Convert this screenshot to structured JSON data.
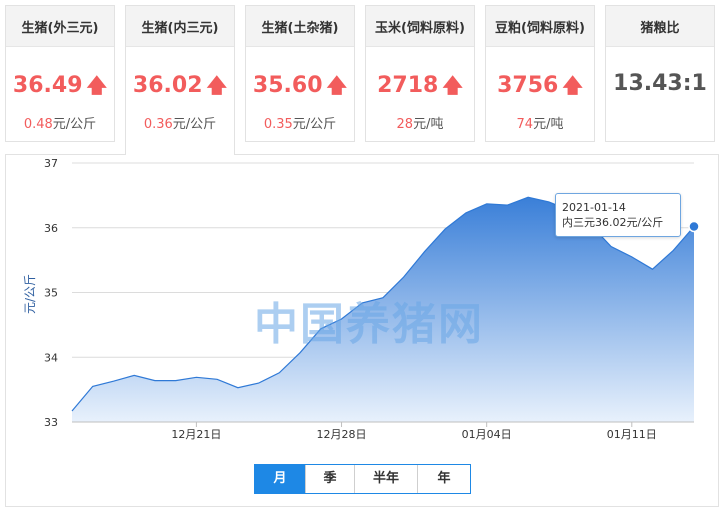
{
  "tabs": [
    {
      "title": "生猪(外三元)",
      "price": "36.49",
      "change": "0.48",
      "unit": "元/公斤",
      "trend": "up"
    },
    {
      "title": "生猪(内三元)",
      "price": "36.02",
      "change": "0.36",
      "unit": "元/公斤",
      "trend": "up"
    },
    {
      "title": "生猪(土杂猪)",
      "price": "35.60",
      "change": "0.35",
      "unit": "元/公斤",
      "trend": "up"
    },
    {
      "title": "玉米(饲料原料)",
      "price": "2718",
      "change": "28",
      "unit": "元/吨",
      "trend": "up"
    },
    {
      "title": "豆粕(饲料原料)",
      "price": "3756",
      "change": "74",
      "unit": "元/吨",
      "trend": "up"
    },
    {
      "title": "猪粮比",
      "price": "13.43:1"
    }
  ],
  "arrow_glyph": "🡅",
  "watermark": "中国养猪网",
  "tooltip": {
    "date": "2021-01-14",
    "text": "内三元36.02元/公斤"
  },
  "range_buttons": [
    "月",
    "季",
    "半年",
    "年"
  ],
  "colors": {
    "accent": "#1e88e5",
    "price_red": "#f25c5c",
    "area_top": "#3a7fd8",
    "area_bottom": "#e8f1fc"
  },
  "chart_data": {
    "type": "area",
    "ylabel": "元/公斤",
    "ylim": [
      33,
      37
    ],
    "yticks": [
      33,
      34,
      35,
      36,
      37
    ],
    "x": [
      "2020-12-15",
      "2020-12-16",
      "2020-12-17",
      "2020-12-18",
      "2020-12-19",
      "2020-12-20",
      "2020-12-21",
      "2020-12-22",
      "2020-12-23",
      "2020-12-24",
      "2020-12-25",
      "2020-12-26",
      "2020-12-27",
      "2020-12-28",
      "2020-12-29",
      "2020-12-30",
      "2020-12-31",
      "2021-01-01",
      "2021-01-02",
      "2021-01-03",
      "2021-01-04",
      "2021-01-05",
      "2021-01-06",
      "2021-01-07",
      "2021-01-08",
      "2021-01-09",
      "2021-01-10",
      "2021-01-11",
      "2021-01-12",
      "2021-01-13",
      "2021-01-14"
    ],
    "xticks": [
      {
        "date": "2020-12-21",
        "label": "12月21日"
      },
      {
        "date": "2020-12-28",
        "label": "12月28日"
      },
      {
        "date": "2021-01-04",
        "label": "01月04日"
      },
      {
        "date": "2021-01-11",
        "label": "01月11日"
      }
    ],
    "series": [
      {
        "values": [
          33.17,
          33.55,
          33.63,
          33.72,
          33.64,
          33.64,
          33.69,
          33.66,
          33.53,
          33.6,
          33.76,
          34.07,
          34.44,
          34.59,
          34.84,
          34.92,
          35.24,
          35.63,
          35.98,
          36.23,
          36.37,
          36.35,
          36.47,
          36.4,
          36.27,
          36.05,
          35.71,
          35.55,
          35.36,
          35.65,
          36.02
        ]
      }
    ],
    "grid": true,
    "highlight_index": 30
  }
}
